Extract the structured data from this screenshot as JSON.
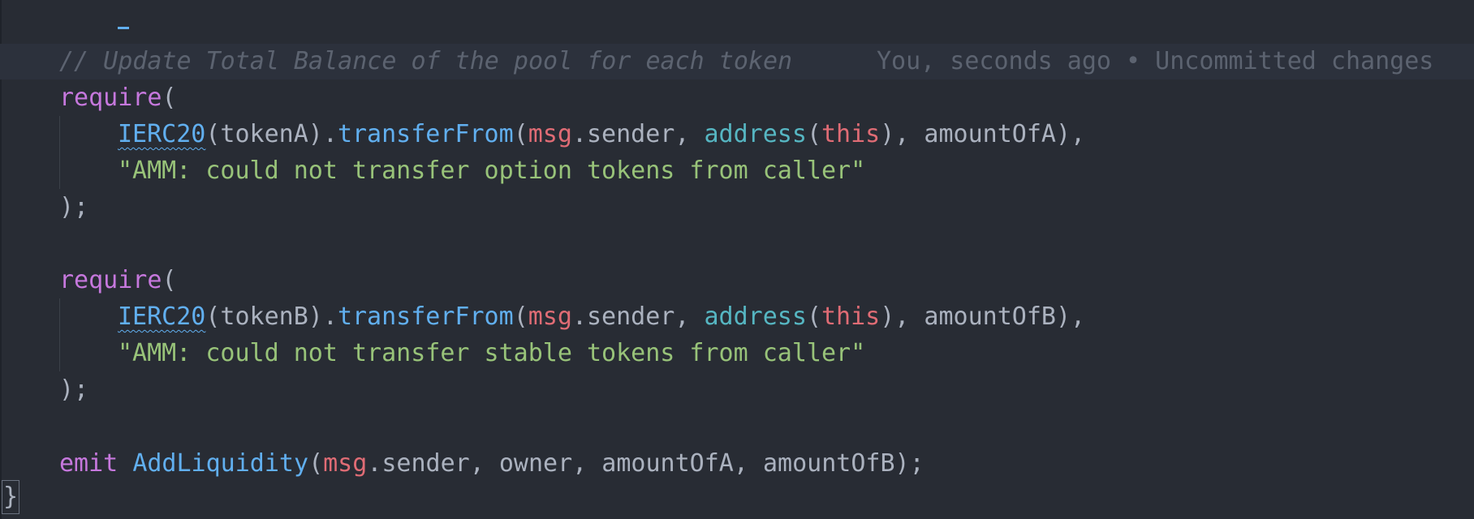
{
  "editor": {
    "comment": "// Update Total Balance of the pool for each token",
    "blame": "You, seconds ago • Uncommitted changes",
    "require_kw": "require",
    "open_paren": "(",
    "close_stmt": ");",
    "blockA": {
      "iface": "IERC20",
      "arg_open": "(tokenA).",
      "method": "transferFrom",
      "paren": "(",
      "msg": "msg",
      "sender": ".sender, ",
      "address_fn": "address",
      "this_kw": "this",
      "tail": "), amountOfA),",
      "message": "\"AMM: could not transfer option tokens from caller\""
    },
    "blockB": {
      "iface": "IERC20",
      "arg_open": "(tokenB).",
      "method": "transferFrom",
      "paren": "(",
      "msg": "msg",
      "sender": ".sender, ",
      "address_fn": "address",
      "this_kw": "this",
      "tail": "), amountOfB),",
      "message": "\"AMM: could not transfer stable tokens from caller\""
    },
    "emit_line": {
      "emit_kw": "emit",
      "event": "AddLiquidity",
      "paren": "(",
      "msg": "msg",
      "rest": ".sender, owner, amountOfA, amountOfB);"
    },
    "closing_brace": "}"
  },
  "colors": {
    "background": "#282c34",
    "keyword": "#c678dd",
    "function": "#61afef",
    "builtin": "#56b6c2",
    "variable": "#e06c75",
    "string": "#98c379",
    "comment": "#5c6370",
    "text": "#abb2bf"
  }
}
